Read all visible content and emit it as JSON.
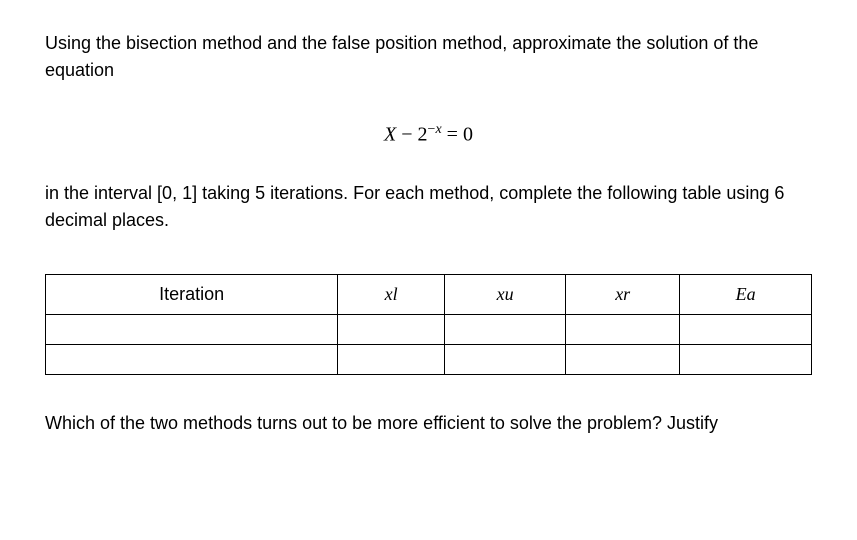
{
  "paragraph1": "Using the bisection method and the false position method, approximate the solution of the equation",
  "equation": {
    "lhs_var": "X",
    "minus": " − ",
    "base": "2",
    "exp_minus": "−",
    "exp_var": "x",
    "equals_zero": " = 0"
  },
  "paragraph2": "in the interval [0, 1] taking 5 iterations. For each method, complete the following table using 6 decimal places.",
  "table": {
    "headers": {
      "iteration": "Iteration",
      "xl": "xl",
      "xu": "xu",
      "xr": "xr",
      "ea": "Ea"
    },
    "rows": [
      {
        "iteration": "",
        "xl": "",
        "xu": "",
        "xr": "",
        "ea": ""
      },
      {
        "iteration": "",
        "xl": "",
        "xu": "",
        "xr": "",
        "ea": ""
      }
    ]
  },
  "paragraph3": "Which of the two methods turns out to be more efficient to solve the problem? Justify"
}
